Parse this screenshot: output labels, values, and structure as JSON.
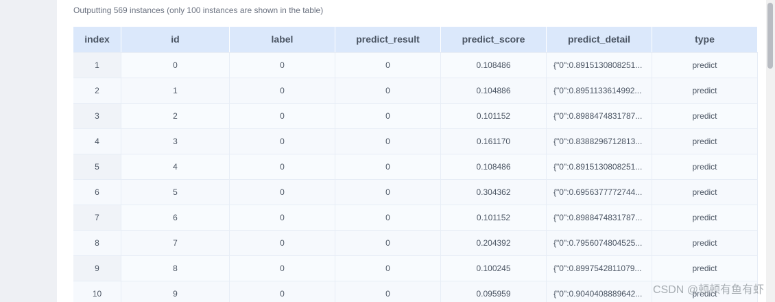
{
  "summary": "Outputting 569 instances (only 100 instances are shown in the table)",
  "table": {
    "headers": [
      "index",
      "id",
      "label",
      "predict_result",
      "predict_score",
      "predict_detail",
      "type"
    ],
    "rows": [
      [
        "1",
        "0",
        "0",
        "0",
        "0.108486",
        "{\"0\":0.8915130808251...",
        "predict"
      ],
      [
        "2",
        "1",
        "0",
        "0",
        "0.104886",
        "{\"0\":0.8951133614992...",
        "predict"
      ],
      [
        "3",
        "2",
        "0",
        "0",
        "0.101152",
        "{\"0\":0.8988474831787...",
        "predict"
      ],
      [
        "4",
        "3",
        "0",
        "0",
        "0.161170",
        "{\"0\":0.8388296712813...",
        "predict"
      ],
      [
        "5",
        "4",
        "0",
        "0",
        "0.108486",
        "{\"0\":0.8915130808251...",
        "predict"
      ],
      [
        "6",
        "5",
        "0",
        "0",
        "0.304362",
        "{\"0\":0.6956377772744...",
        "predict"
      ],
      [
        "7",
        "6",
        "0",
        "0",
        "0.101152",
        "{\"0\":0.8988474831787...",
        "predict"
      ],
      [
        "8",
        "7",
        "0",
        "0",
        "0.204392",
        "{\"0\":0.7956074804525...",
        "predict"
      ],
      [
        "9",
        "8",
        "0",
        "0",
        "0.100245",
        "{\"0\":0.8997542811079...",
        "predict"
      ],
      [
        "10",
        "9",
        "0",
        "0",
        "0.095959",
        "{\"0\":0.9040408889642...",
        "predict"
      ]
    ]
  },
  "watermark": "CSDN @顿顿有鱼有虾"
}
